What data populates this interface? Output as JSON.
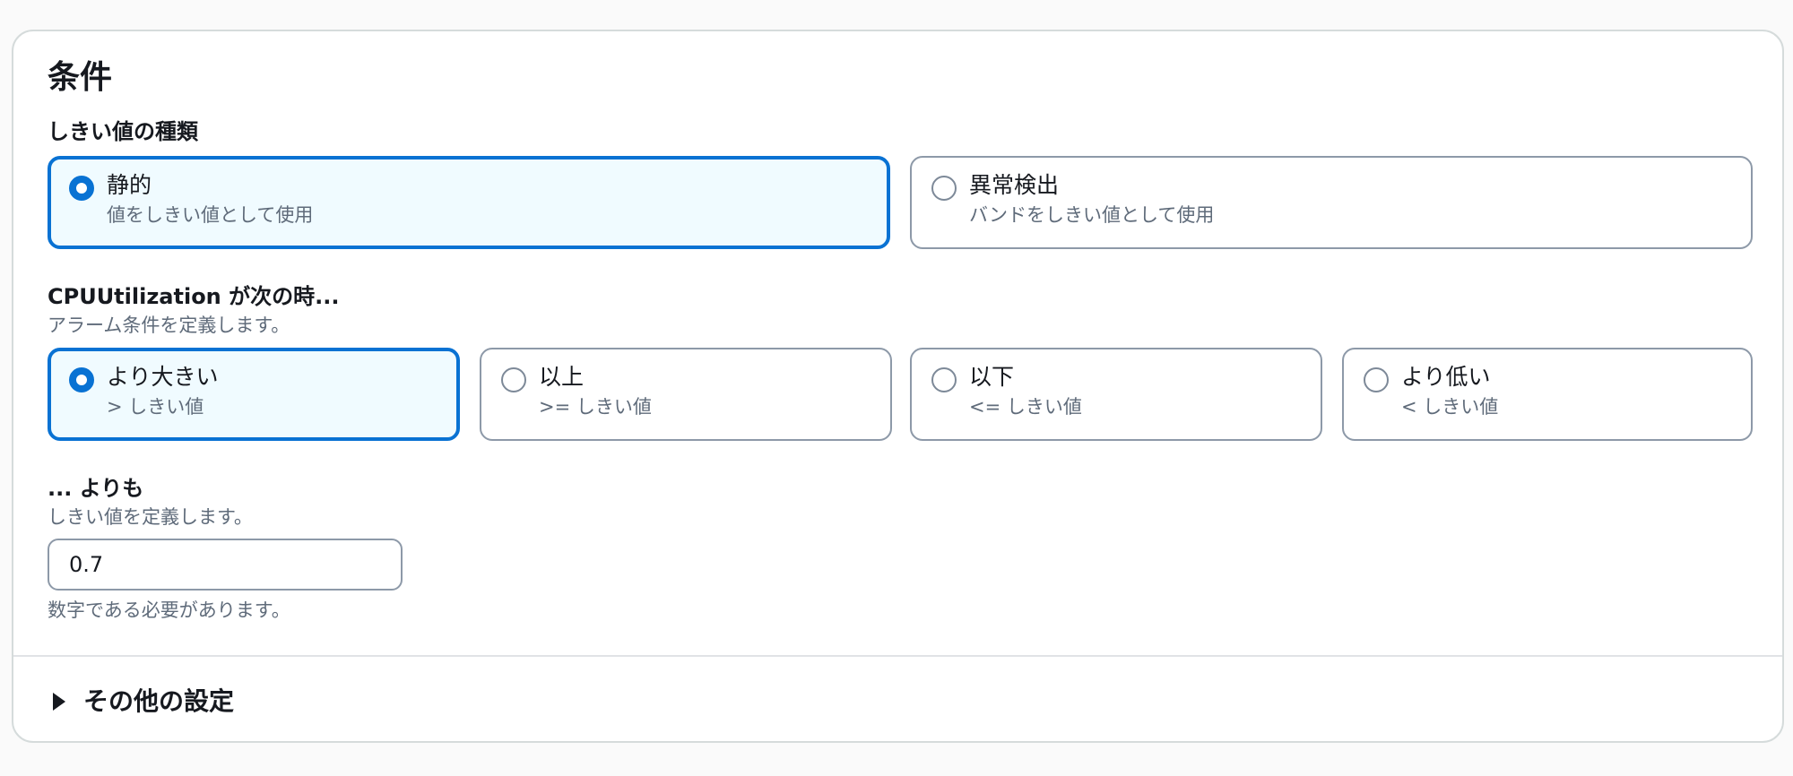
{
  "conditions": {
    "title": "条件",
    "threshold_type": {
      "label": "しきい値の種類",
      "options": [
        {
          "label": "静的",
          "description": "値をしきい値として使用",
          "selected": true
        },
        {
          "label": "異常検出",
          "description": "バンドをしきい値として使用",
          "selected": false
        }
      ]
    },
    "comparison": {
      "label": "CPUUtilization が次の時...",
      "description": "アラーム条件を定義します。",
      "options": [
        {
          "label": "より大きい",
          "description": "> しきい値",
          "selected": true
        },
        {
          "label": "以上",
          "description": ">= しきい値",
          "selected": false
        },
        {
          "label": "以下",
          "description": "<= しきい値",
          "selected": false
        },
        {
          "label": "より低い",
          "description": "< しきい値",
          "selected": false
        }
      ]
    },
    "threshold_value": {
      "label": "... よりも",
      "description": "しきい値を定義します。",
      "value": "0.7",
      "constraint": "数字である必要があります。"
    },
    "additional_settings": {
      "label": "その他の設定",
      "expanded": false
    }
  },
  "colors": {
    "accent": "#0972d3",
    "selected_bg": "#f0fbff",
    "border": "#8d99a8",
    "muted_text": "#5f6b7a"
  },
  "icons": {
    "radio_selected": "radio-selected-icon",
    "radio_unselected": "radio-unselected-icon",
    "expander": "caret-right-icon"
  }
}
